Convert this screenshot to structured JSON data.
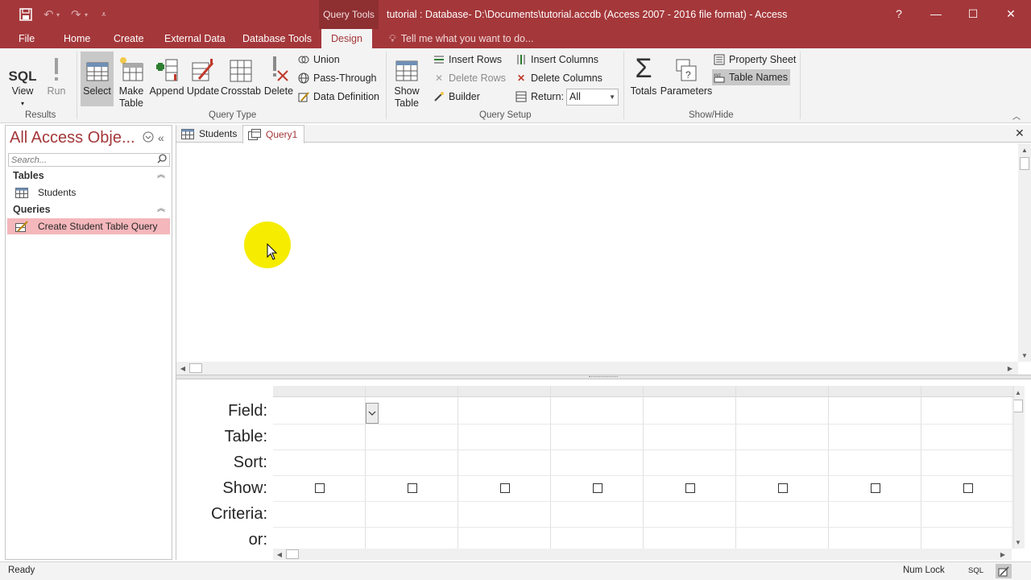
{
  "titlebar": {
    "context_label": "Query Tools",
    "title": "tutorial : Database- D:\\Documents\\tutorial.accdb (Access 2007 - 2016 file format) - Access",
    "help": "?",
    "minimize": "—",
    "maximize": "☐",
    "close": "✕"
  },
  "ribbon_tabs": {
    "file": "File",
    "home": "Home",
    "create": "Create",
    "external_data": "External Data",
    "database_tools": "Database Tools",
    "design": "Design",
    "tell_me": "Tell me what you want to do..."
  },
  "ribbon": {
    "results": {
      "label": "Results",
      "view": "View",
      "run": "Run",
      "sql_icon_text": "SQL"
    },
    "query_type": {
      "label": "Query Type",
      "select": "Select",
      "make_table": [
        "Make",
        "Table"
      ],
      "append": "Append",
      "update": "Update",
      "crosstab": "Crosstab",
      "delete": "Delete",
      "union": "Union",
      "pass_through": "Pass-Through",
      "data_definition": "Data Definition"
    },
    "query_setup": {
      "label": "Query Setup",
      "show_table": [
        "Show",
        "Table"
      ],
      "insert_rows": "Insert Rows",
      "delete_rows": "Delete Rows",
      "builder": "Builder",
      "insert_columns": "Insert Columns",
      "delete_columns": "Delete Columns",
      "return_label": "Return:",
      "return_value": "All"
    },
    "show_hide": {
      "label": "Show/Hide",
      "totals": "Totals",
      "parameters": "Parameters",
      "property_sheet": "Property Sheet",
      "table_names": "Table Names"
    }
  },
  "nav": {
    "title": "All Access Obje...",
    "search_placeholder": "Search...",
    "groups": [
      {
        "label": "Tables",
        "items": [
          "Students"
        ]
      },
      {
        "label": "Queries",
        "items": [
          "Create Student Table Query"
        ]
      }
    ]
  },
  "doc_tabs": [
    "Students",
    "Query1"
  ],
  "design_grid": {
    "row_labels": [
      "Field:",
      "Table:",
      "Sort:",
      "Show:",
      "Criteria:",
      "or:"
    ],
    "column_count": 8,
    "show_checked": [
      false,
      false,
      false,
      false,
      false,
      false,
      false,
      false
    ]
  },
  "statusbar": {
    "status": "Ready",
    "num_lock": "Num Lock",
    "sql_view": "SQL"
  },
  "colors": {
    "accent": "#a4373a",
    "selected_item": "#f4b7bb",
    "cursor_highlight": "#f5ec00"
  }
}
